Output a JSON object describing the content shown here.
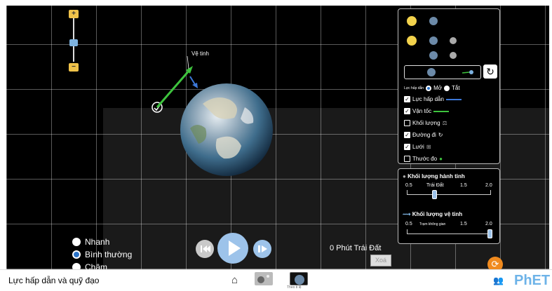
{
  "sim": {
    "satellite_label": "Vệ tinh",
    "time_label": "0 Phút Trái Đất",
    "clear_label": "Xoá",
    "speed_options": [
      "Nhanh",
      "Bình thường",
      "Chậm"
    ],
    "speed_selected": "Bình thường"
  },
  "panel": {
    "gravity_force_label": "Lực hấp dẫn",
    "on_label": "Mở",
    "off_label": "Tắt",
    "checkboxes": [
      {
        "label": "Lực hấp dẫn",
        "checked": true
      },
      {
        "label": "Vận tốc",
        "checked": true
      },
      {
        "label": "Khối lượng",
        "checked": false
      },
      {
        "label": "Đường đi",
        "checked": true
      },
      {
        "label": "Lưới",
        "checked": true
      },
      {
        "label": "Thước đo",
        "checked": false
      }
    ]
  },
  "mass": {
    "planet_title": "Khối lượng hành tinh",
    "planet_ticks": [
      "0.5",
      "Trái Đất",
      "1.5",
      "2.0"
    ],
    "planet_value": 1.0,
    "satellite_title": "Khối lượng vệ tinh",
    "satellite_ticks": [
      "0.5",
      "Trạm không gian",
      "1.5",
      "2.0"
    ],
    "satellite_value": 2.0
  },
  "navbar": {
    "title": "Lực hấp dẫn và quỹ đạo",
    "screen2_label": "Theo tỉ lệ",
    "logo": "PhET"
  },
  "colors": {
    "velocity": "#3ec43e",
    "gravity": "#3c78d8",
    "accent_orange": "#f08a1e",
    "sun": "#f2d24c"
  }
}
